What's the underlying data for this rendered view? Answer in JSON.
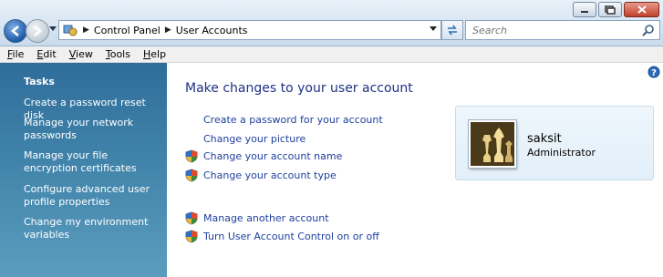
{
  "window": {
    "buttons": {
      "minimize": "minimize-icon",
      "maximize": "maximize-icon",
      "close": "close-icon"
    }
  },
  "address_bar": {
    "breadcrumbs": [
      "Control Panel",
      "User Accounts"
    ],
    "icon": "control-panel-icon"
  },
  "search": {
    "placeholder": "Search"
  },
  "menu": [
    "File",
    "Edit",
    "View",
    "Tools",
    "Help"
  ],
  "sidebar": {
    "title": "Tasks",
    "items": [
      {
        "label": "Create a password reset disk"
      },
      {
        "label": "Manage your network passwords"
      },
      {
        "label": "Manage your file encryption certificates"
      },
      {
        "label": "Configure advanced user profile properties"
      },
      {
        "label": "Change my environment variables"
      }
    ]
  },
  "main": {
    "heading": "Make changes to your user account",
    "links": [
      {
        "label": "Create a password for your account",
        "shield": false
      },
      {
        "label": "Change your picture",
        "shield": false
      },
      {
        "label": "Change your account name",
        "shield": true
      },
      {
        "label": "Change your account type",
        "shield": true
      },
      {
        "label": "Manage another account",
        "shield": true
      },
      {
        "label": "Turn User Account Control on or off",
        "shield": true
      }
    ]
  },
  "user": {
    "name": "saksit",
    "role": "Administrator",
    "picture": "chess-pieces-picture"
  },
  "colors": {
    "sidebar": "#3e81a8",
    "link": "#1e3f9f",
    "heading": "#1e3287"
  }
}
